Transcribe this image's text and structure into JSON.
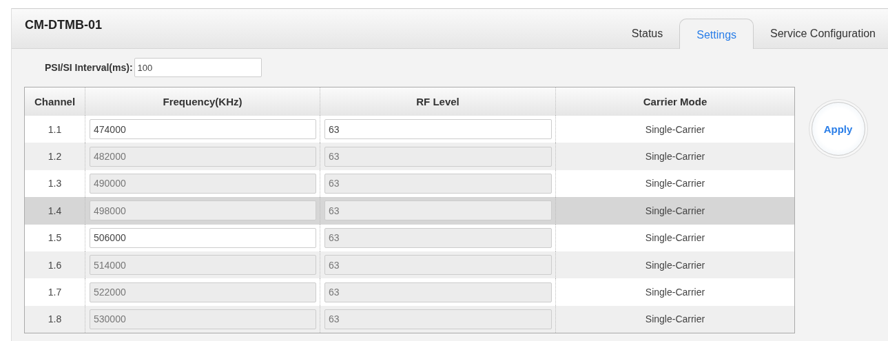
{
  "header": {
    "title": "CM-DTMB-01"
  },
  "tabs": [
    {
      "label": "Status",
      "selected": false
    },
    {
      "label": "Settings",
      "selected": true
    },
    {
      "label": "Service Configuration",
      "selected": false
    }
  ],
  "psi_si": {
    "label": "PSI/SI Interval(ms):",
    "value": "100"
  },
  "table": {
    "columns": [
      "Channel",
      "Frequency(KHz)",
      "RF Level",
      "Carrier Mode"
    ],
    "rows": [
      {
        "channel": "1.1",
        "frequency": "474000",
        "frequency_disabled": false,
        "rf_level": "63",
        "rf_level_disabled": false,
        "carrier_mode": "Single-Carrier",
        "selected": false
      },
      {
        "channel": "1.2",
        "frequency": "482000",
        "frequency_disabled": true,
        "rf_level": "63",
        "rf_level_disabled": true,
        "carrier_mode": "Single-Carrier",
        "selected": false
      },
      {
        "channel": "1.3",
        "frequency": "490000",
        "frequency_disabled": true,
        "rf_level": "63",
        "rf_level_disabled": true,
        "carrier_mode": "Single-Carrier",
        "selected": false
      },
      {
        "channel": "1.4",
        "frequency": "498000",
        "frequency_disabled": true,
        "rf_level": "63",
        "rf_level_disabled": true,
        "carrier_mode": "Single-Carrier",
        "selected": true
      },
      {
        "channel": "1.5",
        "frequency": "506000",
        "frequency_disabled": false,
        "rf_level": "63",
        "rf_level_disabled": true,
        "carrier_mode": "Single-Carrier",
        "selected": false
      },
      {
        "channel": "1.6",
        "frequency": "514000",
        "frequency_disabled": true,
        "rf_level": "63",
        "rf_level_disabled": true,
        "carrier_mode": "Single-Carrier",
        "selected": false
      },
      {
        "channel": "1.7",
        "frequency": "522000",
        "frequency_disabled": true,
        "rf_level": "63",
        "rf_level_disabled": true,
        "carrier_mode": "Single-Carrier",
        "selected": false
      },
      {
        "channel": "1.8",
        "frequency": "530000",
        "frequency_disabled": true,
        "rf_level": "63",
        "rf_level_disabled": true,
        "carrier_mode": "Single-Carrier",
        "selected": false
      }
    ]
  },
  "apply_button": "Apply"
}
